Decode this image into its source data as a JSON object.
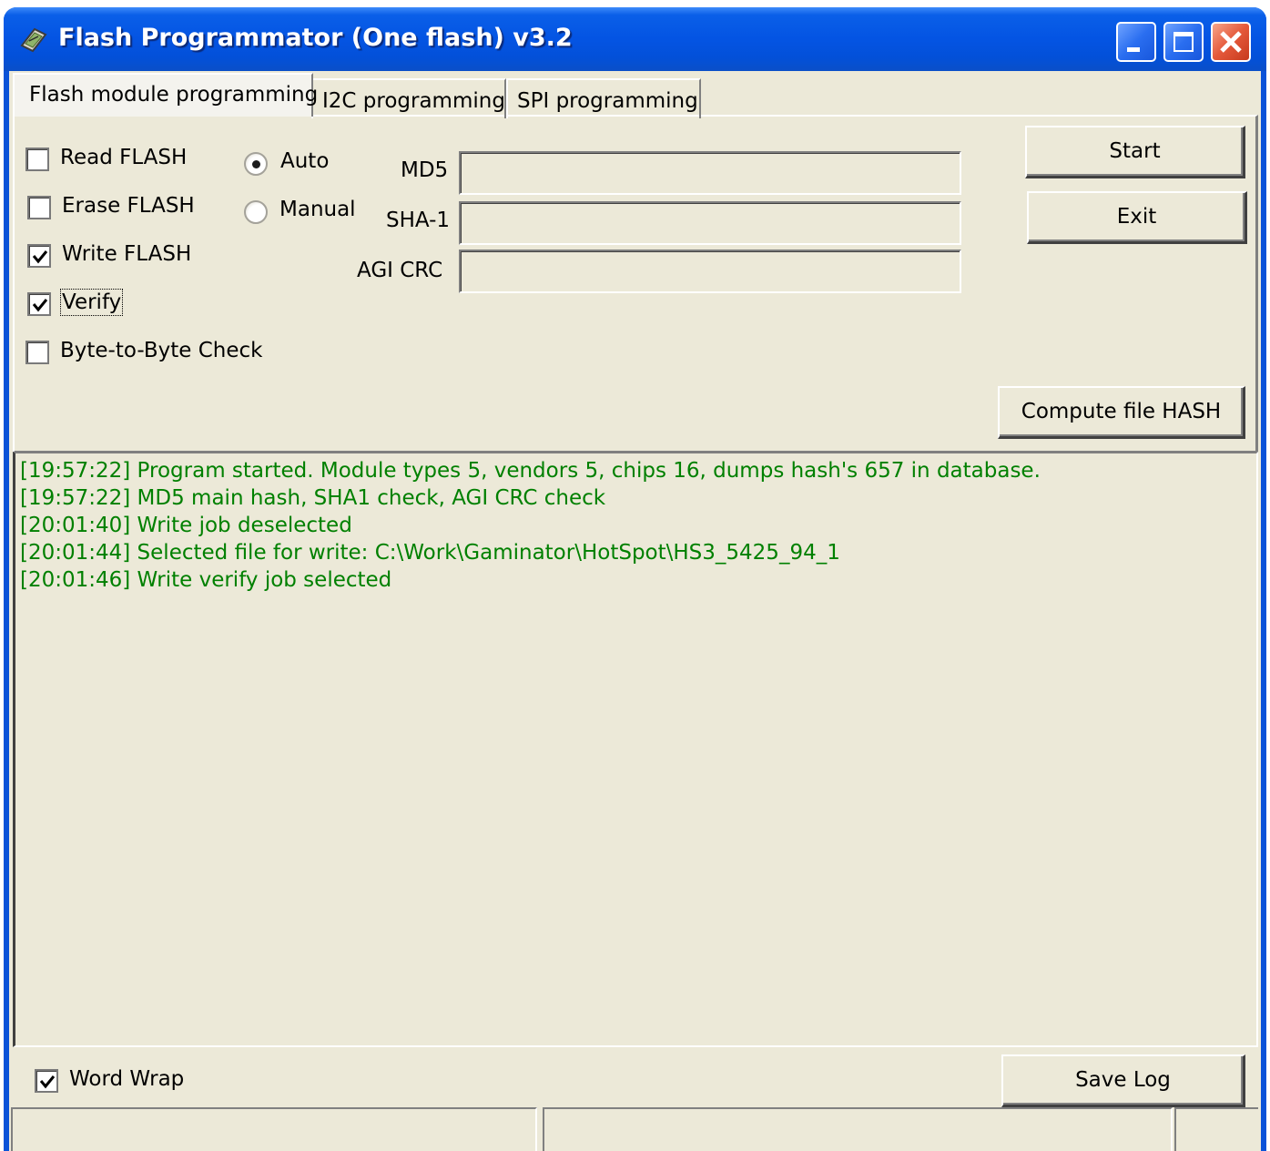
{
  "window": {
    "title": "Flash Programmator (One flash) v3.2"
  },
  "tabs": [
    {
      "label": "Flash module programming",
      "active": true
    },
    {
      "label": "I2C programming",
      "active": false
    },
    {
      "label": "SPI programming",
      "active": false
    }
  ],
  "options": {
    "read_flash": {
      "label": "Read FLASH",
      "checked": false
    },
    "erase_flash": {
      "label": "Erase FLASH",
      "checked": false
    },
    "write_flash": {
      "label": "Write FLASH",
      "checked": true
    },
    "verify": {
      "label": "Verify",
      "checked": true
    },
    "byte_check": {
      "label": "Byte-to-Byte Check",
      "checked": false
    }
  },
  "mode": {
    "auto": {
      "label": "Auto",
      "selected": true
    },
    "manual": {
      "label": "Manual",
      "selected": false
    }
  },
  "hashes": {
    "md5_label": "MD5",
    "md5_value": "",
    "sha1_label": "SHA-1",
    "sha1_value": "",
    "agi_crc_label": "AGI CRC",
    "agi_crc_value": ""
  },
  "buttons": {
    "start": "Start",
    "exit": "Exit",
    "compute_hash": "Compute file HASH",
    "save_log": "Save Log"
  },
  "log": {
    "text_color": "#008000",
    "lines": [
      "[19:57:22] Program started. Module types 5, vendors 5, chips 16, dumps hash's 657 in database.",
      "[19:57:22] MD5 main hash, SHA1 check, AGI CRC check",
      "[20:01:40] Write job deselected",
      "[20:01:44] Selected file for write: C:\\Work\\Gaminator\\HotSpot\\HS3_5425_94_1",
      "[20:01:46] Write verify job selected"
    ]
  },
  "word_wrap": {
    "label": "Word Wrap",
    "checked": true
  },
  "status_bar": {
    "left": "",
    "right": ""
  },
  "colors": {
    "titlebar": "#0454e3",
    "client_bg": "#ece9d8",
    "log_text": "#008000"
  }
}
